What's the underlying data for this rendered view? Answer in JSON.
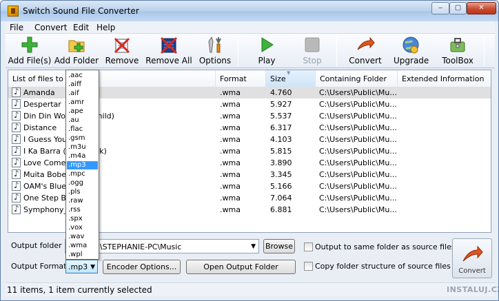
{
  "window": {
    "title": "Switch Sound File Converter",
    "min": "‒",
    "max": "▢",
    "close": "✕"
  },
  "menu": [
    "File",
    "Convert",
    "Edit",
    "Help"
  ],
  "toolbar": {
    "add_files": "Add File(s)",
    "add_folder": "Add Folder",
    "remove": "Remove",
    "remove_all": "Remove All",
    "options": "Options",
    "play": "Play",
    "stop": "Stop",
    "convert": "Convert",
    "upgrade": "Upgrade",
    "toolbox": "ToolBox"
  },
  "list": {
    "headers": [
      "List of files to convert",
      "Format",
      "Size",
      "Containing Folder",
      "Extended Information"
    ],
    "rows": [
      {
        "name": "Amanda",
        "format": ".wma",
        "size": "4.760",
        "folder": "C:\\Users\\Public\\Mu...",
        "selected": true
      },
      {
        "name": "Despertar",
        "format": ".wma",
        "size": "5.927",
        "folder": "C:\\Users\\Public\\Mu..."
      },
      {
        "name": "Din Din Wo (Little Child)",
        "format": ".wma",
        "size": "5.537",
        "folder": "C:\\Users\\Public\\Mu..."
      },
      {
        "name": "Distance",
        "format": ".wma",
        "size": "6.317",
        "folder": "C:\\Users\\Public\\Mu..."
      },
      {
        "name": "I Guess You're Right",
        "format": ".wma",
        "size": "4.103",
        "folder": "C:\\Users\\Public\\Mu..."
      },
      {
        "name": "I Ka Barra (Your Work)",
        "format": ".wma",
        "size": "5.815",
        "folder": "C:\\Users\\Public\\Mu..."
      },
      {
        "name": "Love Comes",
        "format": ".wma",
        "size": "3.890",
        "folder": "C:\\Users\\Public\\Mu..."
      },
      {
        "name": "Muita Bobeira",
        "format": ".wma",
        "size": "3.345",
        "folder": "C:\\Users\\Public\\Mu..."
      },
      {
        "name": "OAM's Blues",
        "format": ".wma",
        "size": "5.166",
        "folder": "C:\\Users\\Public\\Mu..."
      },
      {
        "name": "One Step Beyond",
        "format": ".wma",
        "size": "7.064",
        "folder": "C:\\Users\\Public\\Mu..."
      },
      {
        "name": "Symphony_No_3",
        "format": ".wma",
        "size": "6.881",
        "folder": "C:\\Users\\Public\\Mu..."
      }
    ]
  },
  "format_options": [
    ".aac",
    ".aiff",
    ".aif",
    ".amr",
    ".ape",
    ".au",
    ".flac",
    ".gsm",
    ".m3u",
    ".m4a",
    ".mp3",
    ".mpc",
    ".ogg",
    ".pls",
    ".raw",
    ".rss",
    ".spx",
    ".vox",
    ".wav",
    ".wma",
    ".wpl"
  ],
  "selected_format_index": 10,
  "bottom": {
    "output_folder_label": "Output folder",
    "output_folder_value": "C:\\Users\\STEPHANIE-PC\\Music",
    "browse": "Browse",
    "same_folder": "Output to same folder as source files",
    "output_format_label": "Output Format",
    "output_format_value": ".mp3",
    "encoder_options": "Encoder Options...",
    "open_output_folder": "Open Output Folder",
    "copy_structure": "Copy folder structure of source files",
    "convert_big": "Convert"
  },
  "status": {
    "text": "11 items, 1 item currently selected",
    "watermark": "INSTALUJ.CZ"
  }
}
